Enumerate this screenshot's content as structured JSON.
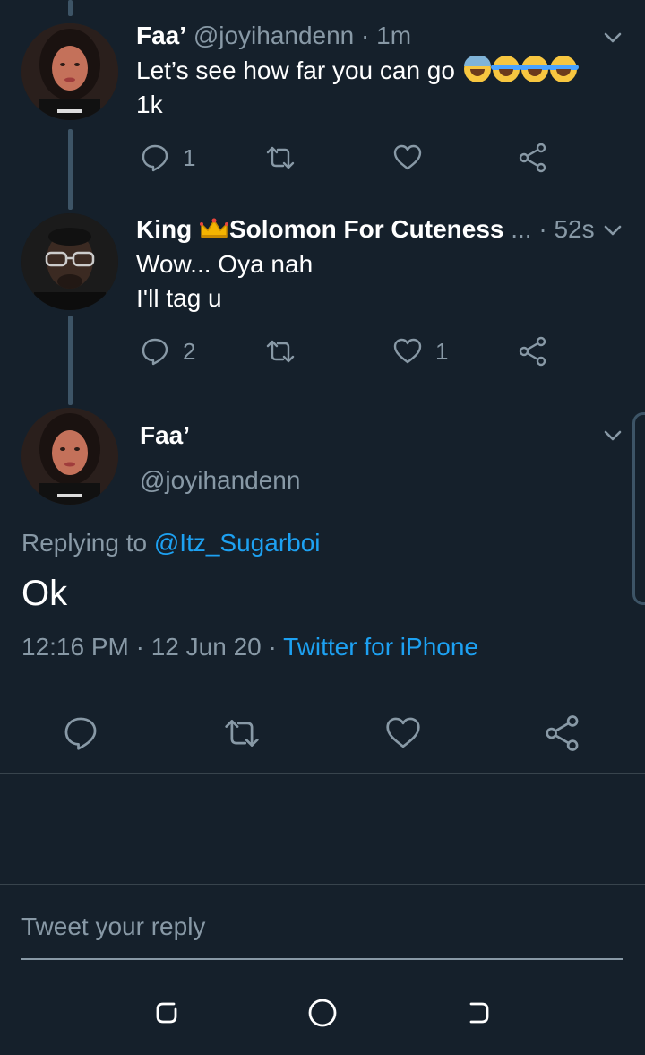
{
  "tweets": [
    {
      "name": "Faa’",
      "handle": "@joyihandenn",
      "time": "· 1m",
      "line1": "Let’s see how far you can go ",
      "line2": "1k",
      "reply_count": "1",
      "like_count": ""
    },
    {
      "name_a": "King ",
      "name_b": "Solomon For Cuteness",
      "ellipsis": "...",
      "time": "· 52s",
      "line1": "Wow... Oya nah",
      "line2": "I'll tag u",
      "reply_count": "2",
      "like_count": "1"
    }
  ],
  "main": {
    "name": "Faa’",
    "handle": "@joyihandenn",
    "replying_prefix": "Replying to ",
    "replying_handle": "@Itz_Sugarboi",
    "text": "Ok",
    "timestamp": "12:16 PM · 12 Jun 20 · ",
    "source": "Twitter for iPhone"
  },
  "reply": {
    "placeholder": "Tweet your reply"
  },
  "colors": {
    "background": "#15202b",
    "muted": "#8899a6",
    "link": "#1da1f2",
    "divider": "#38444d"
  },
  "icons": [
    "reply-icon",
    "retweet-icon",
    "like-icon",
    "share-icon",
    "chevron-down-icon",
    "crown-icon",
    "recents-icon",
    "home-icon",
    "back-icon"
  ]
}
